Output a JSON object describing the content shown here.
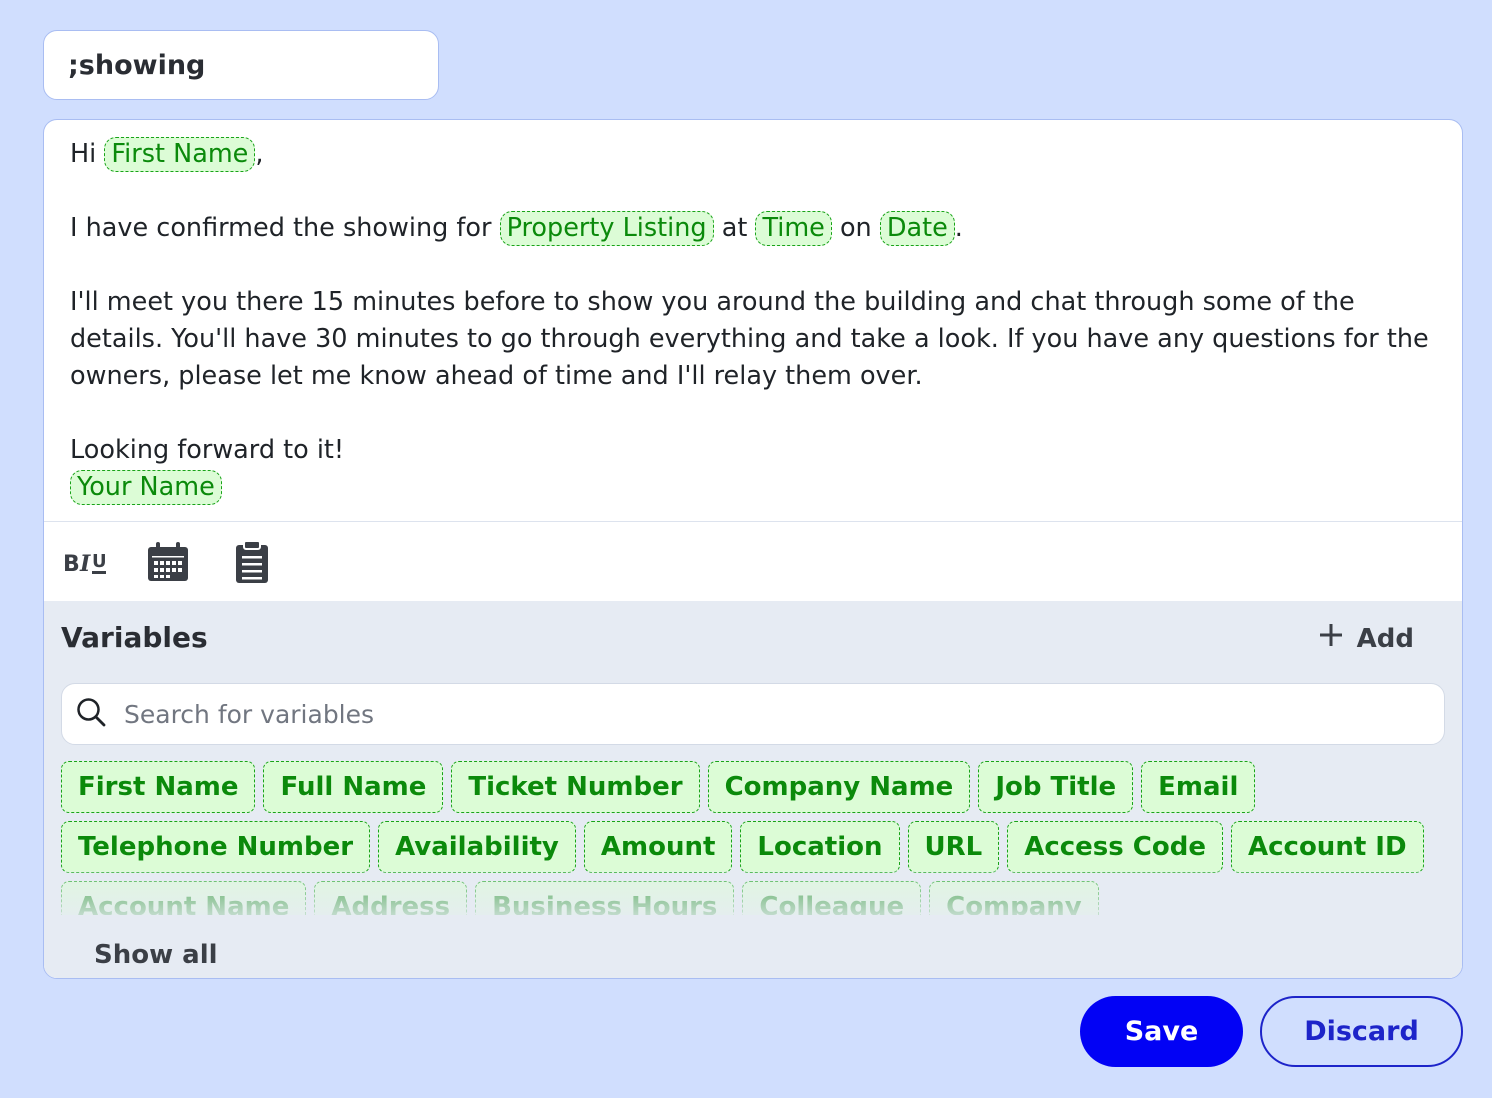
{
  "shortcut": {
    "value": ";showing"
  },
  "message": {
    "greeting_prefix": "Hi",
    "greeting_var": "First Name",
    "greeting_suffix": ",",
    "line2_a": "I have confirmed the showing for",
    "line2_var1": "Property Listing",
    "line2_b": "at",
    "line2_var2": "Time",
    "line2_c": "on",
    "line2_var3": "Date",
    "line2_d": ".",
    "paragraph": "I'll meet you there 15 minutes before to show you around the building and chat through some of the details. You'll have 30 minutes to go through everything and take a look. If you have any questions for the owners, please let me know ahead of time and I'll relay them over.",
    "closing": "Looking forward to it!",
    "signature_var": "Your Name"
  },
  "toolbar": {
    "format_icon": "bold-italic-underline-icon",
    "calendar_icon": "calendar-icon",
    "clipboard_icon": "clipboard-icon"
  },
  "variables": {
    "title": "Variables",
    "add_label": "Add",
    "search_placeholder": "Search for variables",
    "rows": [
      [
        "First Name",
        "Full Name",
        "Ticket Number",
        "Company Name",
        "Job Title",
        "Email"
      ],
      [
        "Telephone Number",
        "Availability",
        "Amount",
        "Location",
        "URL",
        "Access Code",
        "Account ID"
      ],
      [
        "Account Name",
        "Address",
        "Business Hours",
        "Colleague",
        "Company"
      ]
    ],
    "show_all": "Show all"
  },
  "actions": {
    "save": "Save",
    "discard": "Discard"
  },
  "colors": {
    "background": "#d0defe",
    "variable_chip_bg": "#dcfcd6",
    "variable_chip_text": "#0b8a0b",
    "save_button": "#0202f5",
    "discard_border": "#1d24c9"
  }
}
